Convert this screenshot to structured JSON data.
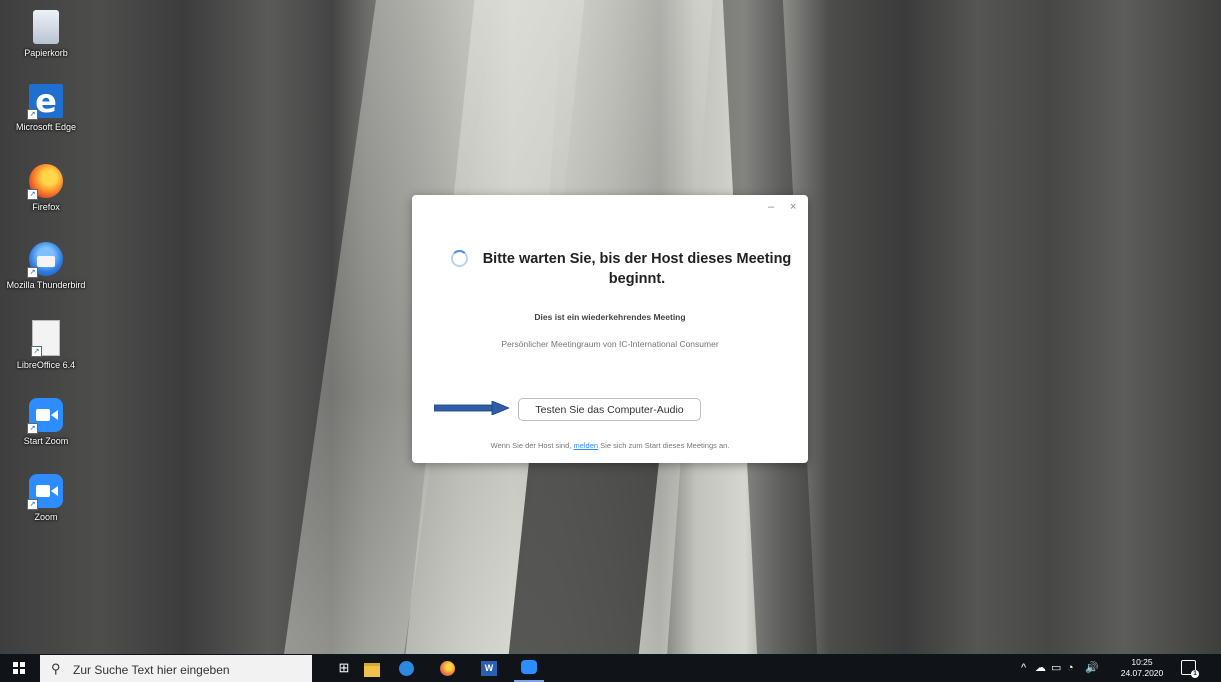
{
  "desktop": {
    "icons": [
      {
        "label": "Papierkorb",
        "icon": "recycle-bin-icon"
      },
      {
        "label": "Microsoft Edge",
        "icon": "edge-icon"
      },
      {
        "label": "Firefox",
        "icon": "firefox-icon"
      },
      {
        "label": "Mozilla Thunderbird",
        "icon": "thunderbird-icon"
      },
      {
        "label": "LibreOffice 6.4",
        "icon": "libreoffice-icon"
      },
      {
        "label": "Start Zoom",
        "icon": "zoom-icon"
      },
      {
        "label": "Zoom",
        "icon": "zoom-icon"
      }
    ]
  },
  "dialog": {
    "minimize_glyph": "–",
    "close_glyph": "×",
    "heading": "Bitte warten Sie, bis der Host dieses Meeting beginnt.",
    "meeting_type": "Dies ist ein wiederkehrendes Meeting",
    "meeting_room": "Persönlicher Meetingraum von IC-International Consumer",
    "test_audio_button": "Testen Sie das Computer-Audio",
    "footer_before": "Wenn Sie der Host sind,",
    "footer_link": "melden",
    "footer_after": "Sie sich zum Start dieses Meetings an."
  },
  "annotation": {
    "arrow_color": "#2f5fa8"
  },
  "taskbar": {
    "search_placeholder": "Zur Suche Text hier eingeben",
    "apps": [
      "task-view-icon",
      "file-explorer-icon",
      "edge-icon",
      "firefox-icon",
      "word-icon",
      "zoom-icon"
    ],
    "word_letter": "W",
    "tray": {
      "up_glyph": "^",
      "volume_glyph": "🔊"
    },
    "clock_time": "10:25",
    "clock_date": "24.07.2020",
    "notification_count": "1"
  },
  "colors": {
    "zoom_blue": "#2d8cff",
    "taskbar": "#101418"
  }
}
